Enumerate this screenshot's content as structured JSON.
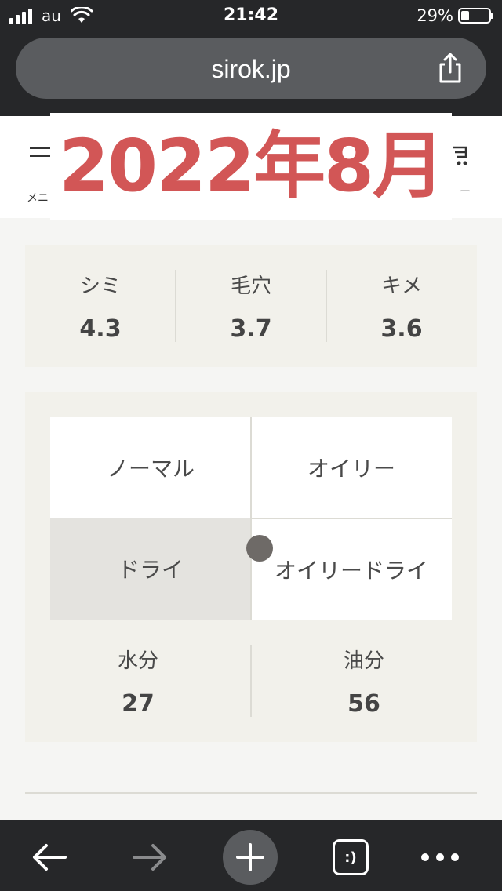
{
  "status_bar": {
    "carrier": "au",
    "time": "21:42",
    "battery_percent": "29%",
    "battery_level": 0.29
  },
  "browser": {
    "url": "sirok.jp"
  },
  "header": {
    "menu_label": "メニ",
    "cart_label": "ー",
    "overlay_title": "2022年8月",
    "overlay_color": "#d25656"
  },
  "stats": [
    {
      "label": "シミ",
      "value": "4.3"
    },
    {
      "label": "毛穴",
      "value": "3.7"
    },
    {
      "label": "キメ",
      "value": "3.6"
    }
  ],
  "skin_type": {
    "quadrants": {
      "top_left": "ノーマル",
      "top_right": "オイリー",
      "bottom_left": "ドライ",
      "bottom_right": "オイリードライ"
    },
    "highlighted": "ドライ",
    "moisture": {
      "label": "水分",
      "value": "27"
    },
    "oil": {
      "label": "油分",
      "value": "56"
    }
  },
  "toolbar": {
    "icons": [
      "back-arrow-icon",
      "forward-arrow-icon",
      "plus-icon",
      "tabs-icon",
      "more-icon"
    ],
    "tabs_glyph": ":)"
  }
}
